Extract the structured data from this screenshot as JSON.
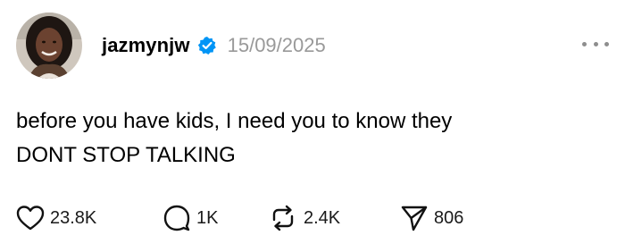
{
  "post": {
    "username": "jazmynjw",
    "timestamp": "15/09/2025",
    "verified": true,
    "text_lines": [
      "before you have kids, I need you to know they",
      "DONT STOP TALKING"
    ],
    "stats": {
      "likes": "23.8K",
      "replies": "1K",
      "reposts": "2.4K",
      "shares": "806"
    }
  },
  "icons": {
    "avatar": "profile-photo",
    "verified": "verified-badge-icon",
    "more": "more-options-icon",
    "like": "heart-icon",
    "reply": "speech-bubble-icon",
    "repost": "repost-arrows-icon",
    "share": "paper-plane-icon"
  },
  "colors": {
    "verified_badge": "#0095f6",
    "timestamp": "#999999",
    "text": "#000000"
  }
}
